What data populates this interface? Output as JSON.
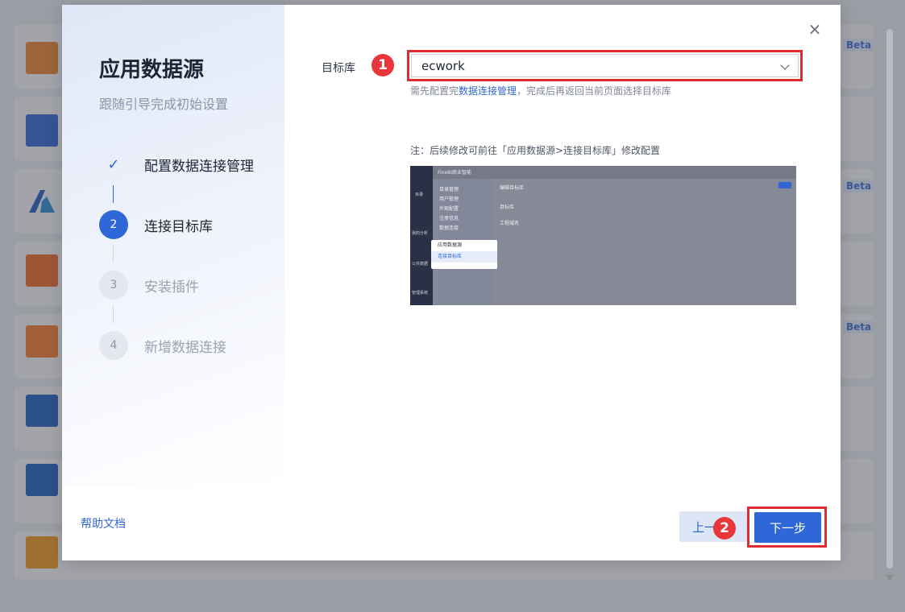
{
  "modal": {
    "title": "应用数据源",
    "subtitle": "跟随引导完成初始设置",
    "close_icon": "×",
    "help_link": "帮助文档"
  },
  "steps": [
    {
      "marker": "✓",
      "label": "配置数据连接管理",
      "state": "done"
    },
    {
      "marker": "2",
      "label": "连接目标库",
      "state": "active"
    },
    {
      "marker": "3",
      "label": "安装插件",
      "state": "todo"
    },
    {
      "marker": "4",
      "label": "新增数据连接",
      "state": "todo"
    }
  ],
  "form": {
    "target_label": "目标库",
    "target_value": "ecwork",
    "hint_prefix": "需先配置完",
    "hint_link": "数据连接管理",
    "hint_suffix": "，完成后再返回当前页面选择目标库",
    "note": "注：后续修改可前往「应用数据源>连接目标库」修改配置"
  },
  "annotations": {
    "badge_1": "1",
    "badge_2": "2"
  },
  "preview": {
    "app_title": "FineBI商业智能",
    "menu_items": [
      "目录管理",
      "用户管理",
      "外观配置",
      "注册信息",
      "数据连接"
    ],
    "content_title": "编辑目标库",
    "content_rows": [
      "目标库",
      "工程域名"
    ],
    "popup_parent": "应用数据源",
    "popup_child": "连接目标库",
    "side_items": [
      "目录",
      "我的分析",
      "公共数据",
      "管理系统"
    ]
  },
  "footer": {
    "prev_label": "上一步",
    "next_label": "下一步"
  },
  "background": {
    "beta_labels": [
      "Beta",
      "Beta",
      "Beta"
    ]
  },
  "colors": {
    "primary": "#2f66d8",
    "annotation_red": "#e02b30"
  }
}
